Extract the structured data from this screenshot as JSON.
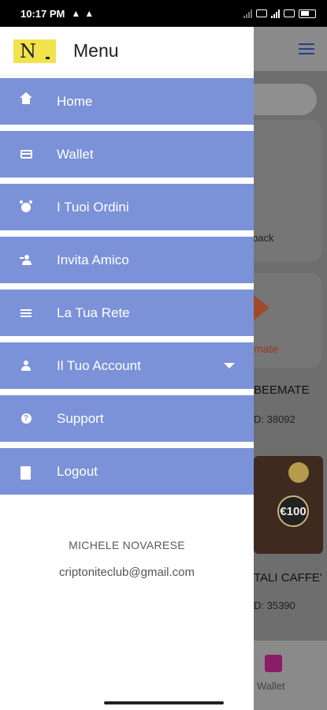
{
  "status_bar": {
    "time": "10:17 PM",
    "warnings": [
      "▲",
      "▲"
    ]
  },
  "drawer": {
    "logo_text": "N",
    "title": "Menu",
    "items": [
      {
        "label": "Home",
        "icon": "home-icon"
      },
      {
        "label": "Wallet",
        "icon": "card-icon"
      },
      {
        "label": "I Tuoi Ordini",
        "icon": "alarm-icon"
      },
      {
        "label": "Invita Amico",
        "icon": "add-user-icon"
      },
      {
        "label": "La Tua Rete",
        "icon": "list-icon"
      },
      {
        "label": "Il Tuo Account",
        "icon": "user-icon",
        "has_dropdown": true
      },
      {
        "label": "Support",
        "icon": "help-icon"
      },
      {
        "label": "Logout",
        "icon": "logout-icon"
      }
    ],
    "user": {
      "name": "MICHELE NOVARESE",
      "email": "criptoniteclub@gmail.com"
    }
  },
  "background": {
    "card1_label": "back",
    "card2_label": "mate",
    "product1_name": "BEEMATE",
    "product1_id": "D: 38092",
    "coffee_badge": "€100",
    "product2_name": "TALI CAFFE'",
    "product2_id": "D: 35390",
    "bottom_nav_label": "Wallet"
  },
  "colors": {
    "menu_item_bg": "#7b92d9",
    "accent": "#2b3f88",
    "logo_bg": "#f1e34c"
  }
}
